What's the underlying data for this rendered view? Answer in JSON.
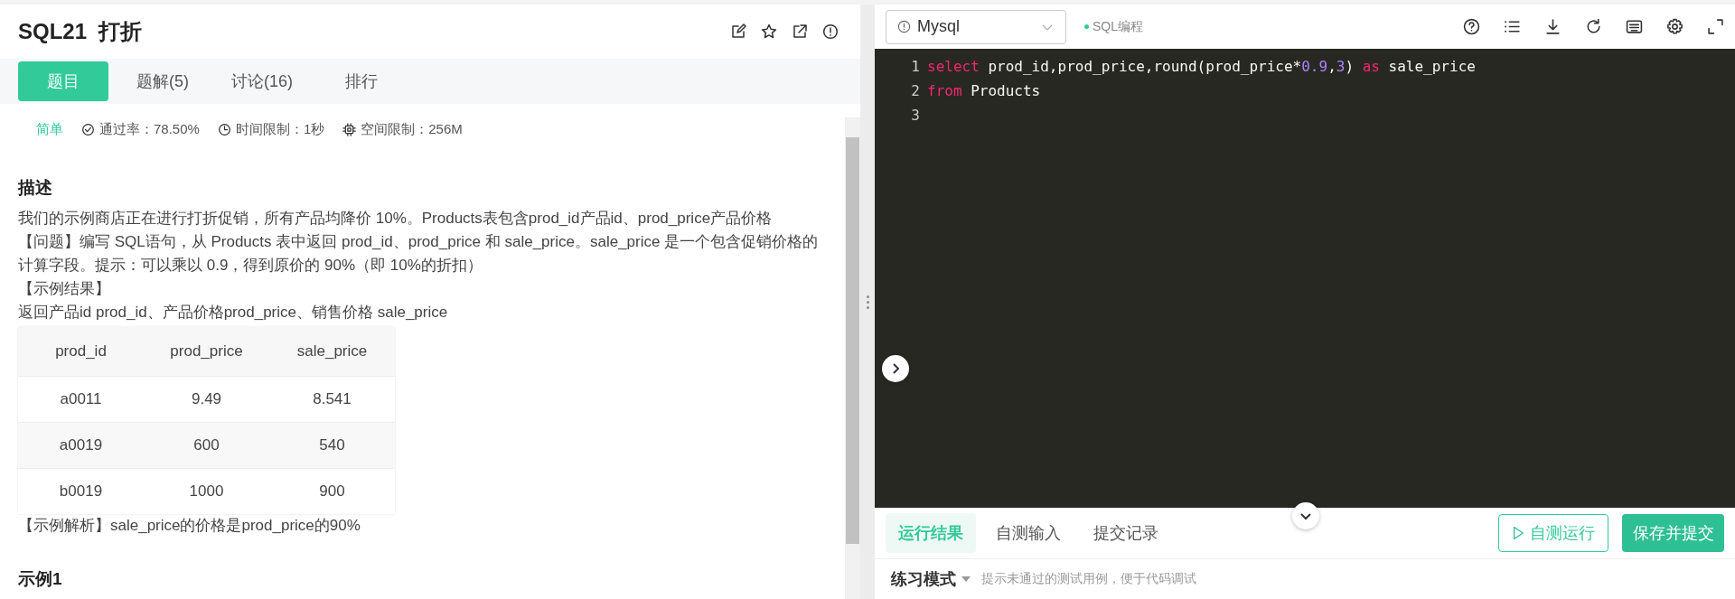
{
  "problem": {
    "title": "SQL21  打折",
    "actions": [
      {
        "kind": "edit"
      },
      {
        "kind": "star"
      },
      {
        "kind": "share"
      },
      {
        "kind": "report"
      }
    ]
  },
  "tabs": [
    {
      "label": "题目",
      "selected": true
    },
    {
      "label": "题解(5)",
      "selected": false
    },
    {
      "label": "讨论(16)",
      "selected": false
    },
    {
      "label": "排行",
      "selected": false
    }
  ],
  "meta": {
    "difficulty": "简单",
    "items": [
      {
        "kind": "pass",
        "text": "通过率：78.50%"
      },
      {
        "kind": "time",
        "text": "时间限制：1秒"
      },
      {
        "kind": "memory",
        "text": "空间限制：256M"
      }
    ]
  },
  "description": {
    "heading": "描述",
    "paragraphs": [
      "我们的示例商店正在进行打折促销，所有产品均降价 10%。Products表包含prod_id产品id、prod_price产品价格",
      "【问题】编写 SQL语句，从 Products 表中返回 prod_id、prod_price 和 sale_price。sale_price 是一个包含促销价格的计算字段。提示：可以乘以 0.9，得到原价的 90%（即 10%的折扣）",
      "【示例结果】",
      "返回产品id prod_id、产品价格prod_price、销售价格 sale_price"
    ],
    "table": {
      "columns": [
        "prod_id",
        "prod_price",
        "sale_price"
      ],
      "rows": [
        [
          "a0011",
          "9.49",
          "8.541"
        ],
        [
          "a0019",
          "600",
          "540"
        ],
        [
          "b0019",
          "1000",
          "900"
        ]
      ]
    },
    "note": "【示例解析】sale_price的价格是prod_price的90%"
  },
  "example_heading": "示例1",
  "editor": {
    "language": "Mysql",
    "mode": "SQL编程",
    "tools": [
      {
        "kind": "help"
      },
      {
        "kind": "list"
      },
      {
        "kind": "download"
      },
      {
        "kind": "reload"
      },
      {
        "kind": "keyboard"
      },
      {
        "kind": "settings"
      },
      {
        "kind": "fullscreen"
      }
    ],
    "lines": [
      {
        "number": "1",
        "tokens": [
          {
            "kind": "keyword",
            "text": "select"
          },
          {
            "kind": "plain",
            "text": " prod_id,prod_price,round(prod_price*"
          },
          {
            "kind": "number",
            "text": "0.9"
          },
          {
            "kind": "plain",
            "text": ","
          },
          {
            "kind": "number",
            "text": "3"
          },
          {
            "kind": "plain",
            "text": ") "
          },
          {
            "kind": "keyword",
            "text": "as"
          },
          {
            "kind": "plain",
            "text": " sale_price"
          }
        ]
      },
      {
        "number": "2",
        "tokens": [
          {
            "kind": "keyword",
            "text": "from"
          },
          {
            "kind": "plain",
            "text": " Products"
          }
        ]
      },
      {
        "number": "3"
      }
    ]
  },
  "result_tabs": [
    {
      "label": "运行结果",
      "selected": true
    },
    {
      "label": "自测输入",
      "selected": false
    },
    {
      "label": "提交记录",
      "selected": false
    }
  ],
  "buttons": {
    "run": "自测运行",
    "submit": "保存并提交"
  },
  "practice": {
    "mode": "练习模式",
    "hint": "提示未通过的测试用例，便于代码调试"
  }
}
